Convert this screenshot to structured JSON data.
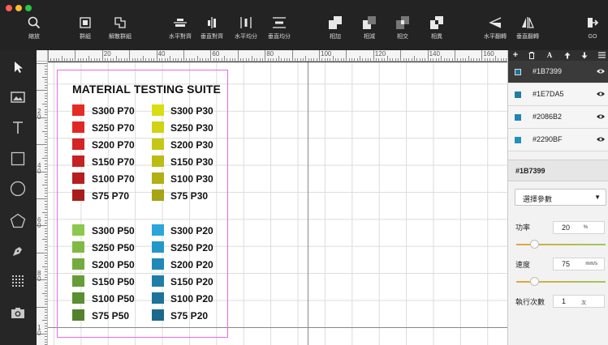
{
  "window": {
    "traffic_lights": [
      "#ff5f57",
      "#febc2e",
      "#28c840"
    ]
  },
  "toolbar": {
    "zoom_label": "縮放",
    "group_label": "群組",
    "ungroup_label": "解散群組",
    "align_h_label": "水平對齊",
    "align_v_label": "垂直對齊",
    "dist_h_label": "水平均分",
    "dist_v_label": "垂直均分",
    "union_label": "相加",
    "subtract_label": "相減",
    "intersect_label": "相交",
    "exclude_label": "相異",
    "flip_h_label": "水平翻轉",
    "flip_v_label": "垂直翻轉",
    "go_label": "GO"
  },
  "ruler": {
    "h_labels": [
      "20",
      "40",
      "60",
      "80",
      "100",
      "120",
      "140",
      "160"
    ],
    "v_labels": [
      "2\n0",
      "4\n0",
      "6\n0",
      "8\n0",
      "1\n0"
    ]
  },
  "canvas": {
    "title": "MATERIAL TESTING SUITE",
    "swatches": [
      {
        "label": "S300 P70",
        "color": "#E52B26"
      },
      {
        "label": "S250 P70",
        "color": "#E12726"
      },
      {
        "label": "S200 P70",
        "color": "#D42424"
      },
      {
        "label": "S150 P70",
        "color": "#C52222"
      },
      {
        "label": "S100 P70",
        "color": "#B61F1F"
      },
      {
        "label": "S75 P70",
        "color": "#A91C1C"
      },
      {
        "label": "S300 P30",
        "color": "#D9DD12"
      },
      {
        "label": "S250 P30",
        "color": "#CFD313"
      },
      {
        "label": "S200 P30",
        "color": "#C5C813"
      },
      {
        "label": "S150 P30",
        "color": "#BBBC14"
      },
      {
        "label": "S100 P30",
        "color": "#B0B114"
      },
      {
        "label": "S75 P30",
        "color": "#A5A515"
      },
      {
        "label": "S300 P50",
        "color": "#8CC84B"
      },
      {
        "label": "S250 P50",
        "color": "#80B944"
      },
      {
        "label": "S200 P50",
        "color": "#74AB3E"
      },
      {
        "label": "S150 P50",
        "color": "#689C38"
      },
      {
        "label": "S100 P50",
        "color": "#5C8E32"
      },
      {
        "label": "S75 P50",
        "color": "#53822C"
      },
      {
        "label": "S300 P20",
        "color": "#2AA6DB"
      },
      {
        "label": "S250 P20",
        "color": "#2497C8"
      },
      {
        "label": "S200 P20",
        "color": "#2189B8"
      },
      {
        "label": "S150 P20",
        "color": "#1F7EA8"
      },
      {
        "label": "S100 P20",
        "color": "#1D7399"
      },
      {
        "label": "S75 P20",
        "color": "#1B6A8C"
      }
    ]
  },
  "layers": [
    {
      "name": "#1B7399",
      "color": "#1B7399",
      "selected": true
    },
    {
      "name": "#1E7DA5",
      "color": "#1E7DA5",
      "selected": false
    },
    {
      "name": "#2086B2",
      "color": "#2086B2",
      "selected": false
    },
    {
      "name": "#2290BF",
      "color": "#2290BF",
      "selected": false
    }
  ],
  "panel": {
    "selected_name": "#1B7399",
    "param_select": "選擇參數",
    "power": {
      "label": "功率",
      "value": "20",
      "unit": "%",
      "level": 0.2
    },
    "speed": {
      "label": "速度",
      "value": "75",
      "unit": "mm/s",
      "level": 0.2
    },
    "passes": {
      "label": "執行次數",
      "value": "1",
      "unit": "次"
    }
  }
}
